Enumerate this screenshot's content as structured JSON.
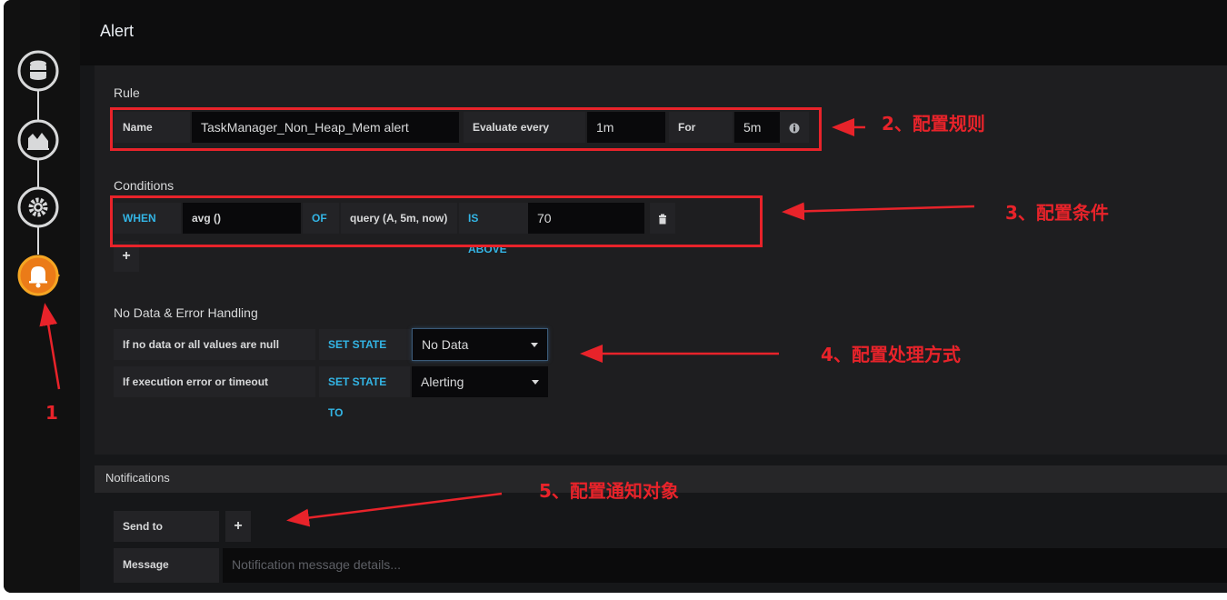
{
  "header": {
    "title": "Alert"
  },
  "sidebar": {
    "steps": [
      {
        "icon": "database-icon"
      },
      {
        "icon": "chart-icon"
      },
      {
        "icon": "gear-icon"
      },
      {
        "icon": "bell-icon",
        "active": true
      }
    ]
  },
  "rule": {
    "section_title": "Rule",
    "name_label": "Name",
    "name_value": "TaskManager_Non_Heap_Mem alert",
    "evaluate_label": "Evaluate every",
    "evaluate_value": "1m",
    "for_label": "For",
    "for_value": "5m"
  },
  "conditions": {
    "section_title": "Conditions",
    "when": "WHEN",
    "reducer": "avg ()",
    "of": "OF",
    "query": "query (A, 5m, now)",
    "evaluator": "IS ABOVE",
    "threshold": "70",
    "add": "+"
  },
  "nodata": {
    "section_title": "No Data & Error Handling",
    "row1_label": "If no data or all values are null",
    "row1_kw": "SET STATE TO",
    "row1_value": "No Data",
    "row2_label": "If execution error or timeout",
    "row2_kw": "SET STATE TO",
    "row2_value": "Alerting"
  },
  "notifications": {
    "section_title": "Notifications",
    "send_to_label": "Send to",
    "add": "+",
    "message_label": "Message",
    "message_placeholder": "Notification message details..."
  },
  "annotations": {
    "a1": "1",
    "a2": "2、配置规则",
    "a3": "3、配置条件",
    "a4": "4、配置处理方式",
    "a5": "5、配置通知对象"
  },
  "colors": {
    "accent": "#33b5e5",
    "annotation": "#e8232a",
    "active_step": "#eb7b18"
  }
}
